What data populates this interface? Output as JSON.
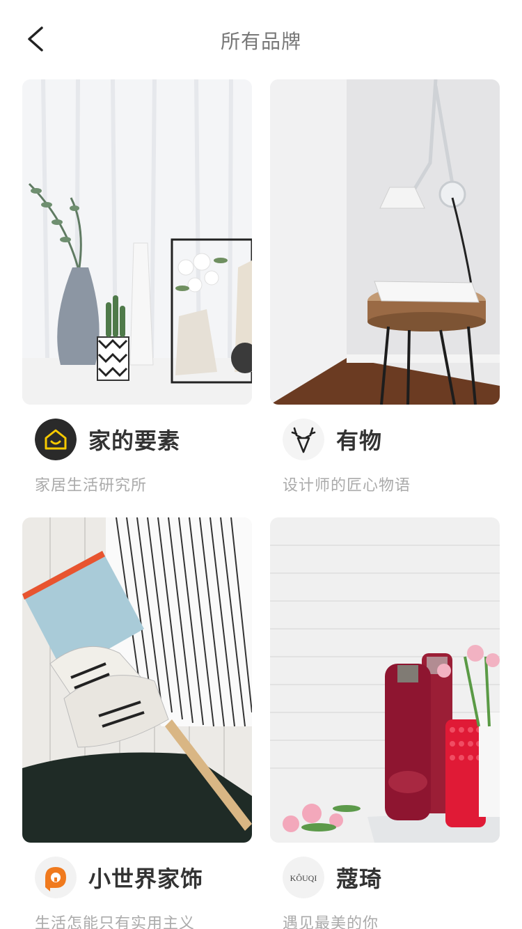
{
  "nav": {
    "title": "所有品牌",
    "back_icon": "chevron-left-icon"
  },
  "brands": [
    {
      "name": "家的要素",
      "desc": "家居生活研究所",
      "logo": "house-smile-icon",
      "accent": "#F6C900"
    },
    {
      "name": "有物",
      "desc": "设计师的匠心物语",
      "logo": "deer-icon",
      "accent": "#222222"
    },
    {
      "name": "小世界家饰",
      "desc": "生活怎能只有实用主义",
      "logo": "orange-house-icon",
      "accent": "#F07A1E"
    },
    {
      "name": "蔻琦",
      "desc": "遇见最美的你",
      "logo_text": "KÔUQI",
      "accent": "#444444"
    }
  ],
  "colors": {
    "background": "#ffffff",
    "title": "#777777",
    "brand_name": "#333333",
    "desc": "#aaaaaa"
  }
}
